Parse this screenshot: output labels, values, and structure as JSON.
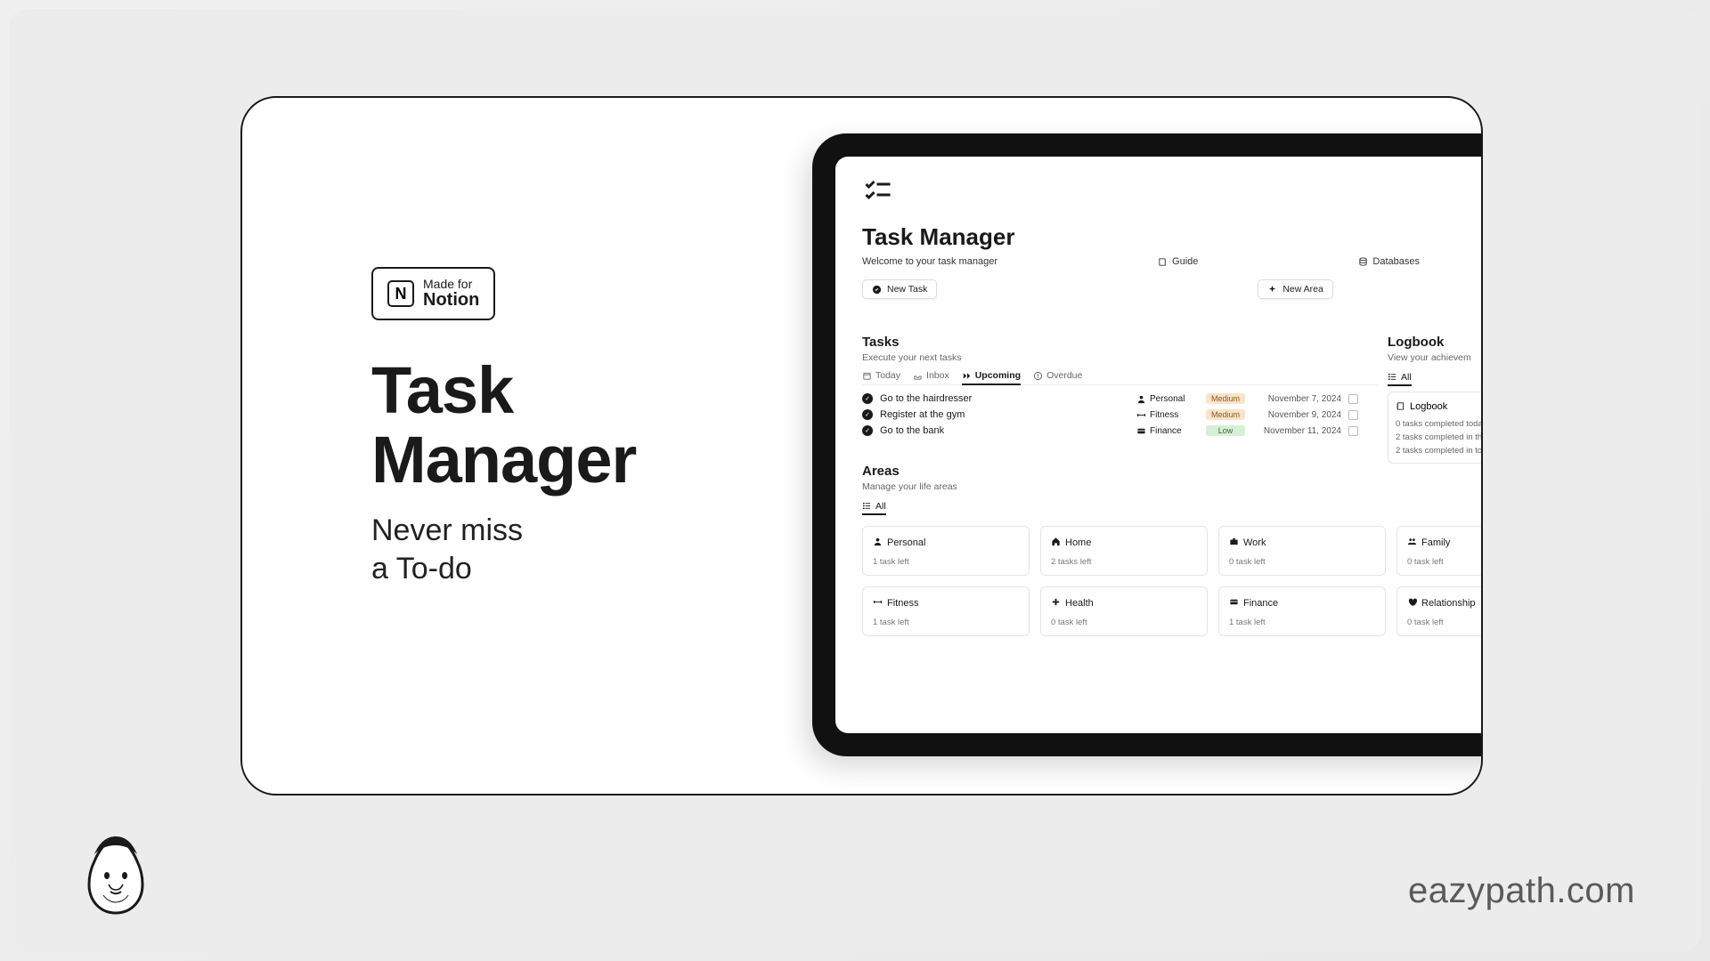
{
  "badge": {
    "line1": "Made for",
    "line2": "Notion"
  },
  "promo": {
    "title_line1": "Task",
    "title_line2": "Manager",
    "sub_line1": "Never miss",
    "sub_line2": "a To-do"
  },
  "app": {
    "title": "Task Manager",
    "welcome": "Welcome to your task manager",
    "guide": "Guide",
    "databases": "Databases",
    "new_task": "New Task",
    "new_area": "New Area"
  },
  "tasks": {
    "heading": "Tasks",
    "sub": "Execute your next tasks",
    "tabs": {
      "today": "Today",
      "inbox": "Inbox",
      "upcoming": "Upcoming",
      "overdue": "Overdue"
    },
    "list": [
      {
        "title": "Go to the hairdresser",
        "area": "Personal",
        "priority": "Medium",
        "priority_class": "prio-medium",
        "date": "November 7, 2024"
      },
      {
        "title": "Register at the gym",
        "area": "Fitness",
        "priority": "Medium",
        "priority_class": "prio-medium",
        "date": "November 9, 2024"
      },
      {
        "title": "Go to the bank",
        "area": "Finance",
        "priority": "Low",
        "priority_class": "prio-low",
        "date": "November 11, 2024"
      }
    ]
  },
  "logbook": {
    "heading": "Logbook",
    "sub": "View your achievem",
    "tab": "All",
    "card_title": "Logbook",
    "lines": [
      "0 tasks completed toda",
      "2 tasks completed in th",
      "2 tasks completed in to"
    ]
  },
  "areas": {
    "heading": "Areas",
    "sub": "Manage your life areas",
    "tab": "All",
    "cards": [
      {
        "name": "Personal",
        "count": "1 task left",
        "icon": "person-icon"
      },
      {
        "name": "Home",
        "count": "2 tasks left",
        "icon": "home-icon"
      },
      {
        "name": "Work",
        "count": "0 task left",
        "icon": "briefcase-icon"
      },
      {
        "name": "Family",
        "count": "0 task left",
        "icon": "people-icon"
      },
      {
        "name": "Fitness",
        "count": "1 task left",
        "icon": "dumbbell-icon"
      },
      {
        "name": "Health",
        "count": "0 task left",
        "icon": "plus-icon"
      },
      {
        "name": "Finance",
        "count": "1 task left",
        "icon": "card-icon"
      },
      {
        "name": "Relationship",
        "count": "0 task left",
        "icon": "heart-icon"
      }
    ]
  },
  "footer": {
    "brand": "eazypath.com"
  }
}
